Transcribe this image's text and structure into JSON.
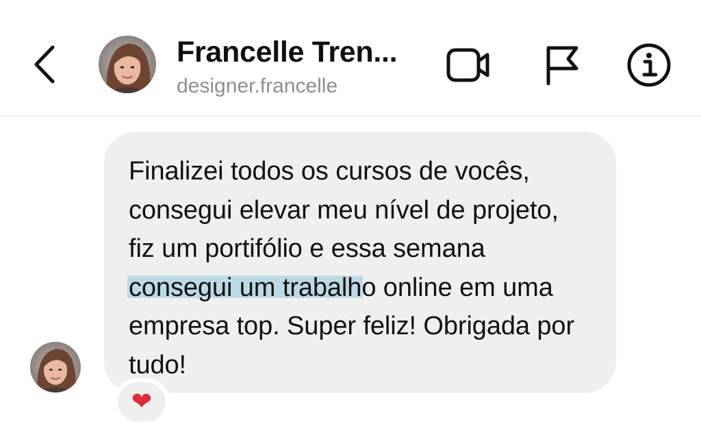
{
  "header": {
    "back_icon": "chevron-left-icon",
    "contact_name": "Francelle Tren...",
    "username": "designer.francelle",
    "actions": [
      "video-call-icon",
      "flag-icon",
      "info-icon"
    ]
  },
  "conversation": {
    "message": {
      "segment_before": "Finalizei todos os cursos de vocês, consegui elevar meu nível de projeto, fiz um portifólio e essa semana ",
      "highlighted": "consegui um trabalh",
      "segment_after": "o online em uma empresa top. Super feliz! Obrigada por tudo!",
      "highlight_color": "#bcd9e6",
      "bubble_color": "#efefef"
    },
    "reaction": {
      "emoji": "❤",
      "color": "#e0283b"
    }
  }
}
